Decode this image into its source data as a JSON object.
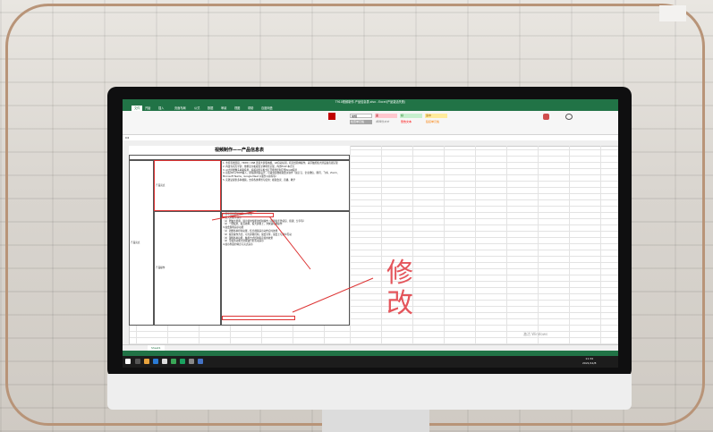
{
  "window": {
    "title": "T910视频制作-产品信息表.xlsx - Excel(产品激活失败)"
  },
  "tabs": [
    "文件",
    "开始",
    "插入",
    "页面布局",
    "公式",
    "数据",
    "审阅",
    "视图",
    "帮助",
    "百度网盘"
  ],
  "ribbon": {
    "styles": [
      "常规",
      "差",
      "好",
      "适中",
      "检查单元格",
      "解释性文本",
      "警告文本",
      "链接单元格"
    ],
    "accent": "#217346"
  },
  "formula_bar": {
    "name_box": "C4"
  },
  "sheet": {
    "title": "视频制作——产品信息表",
    "category": "产品亮点",
    "rows": [
      {
        "label": "产品亮点",
        "text": "1. 支持有线连接，HDMI / USB 连接大屏投电视，AP自动识别，机顶式简体操作，来带触控板大屏设备直观呈现\n2. 内置有机光学屏，便携显示和视觉立体场景呈现，内含ECW 本光灯\n3. AI大屏摄像头两路投屏，超超双屏平板式打开场景控制引擎AI/AR投屏\n4. 搭配AR与HDMI输入，即插即用装设计，可兼容多数视频会议软件（如钉钉、企业微信、腾讯、飞书、Zoom、Microsoft Teams、Google Meet 以服务以前等等）\n5. 实践证提供多种视频，支持各类场景与使用：视频会议、直播、教学"
      },
      {
        "label": "产品操作",
        "text": "1.简单连接即可识别HDMI线\n2.投大屏操作演示\n（1）轻触大屏幕，展示使用性能的控制操作（屏幕和手势感应、授课、分享等）\n（2）一键投屏，提高效率，投大屏幕上，并快速切换操作\n3.展会现场演示功能\n（1）调整各种控制功能，结合视频演示动作实时效果\n（2）投影操作方式，可大屏幕控制，展会宣传，展会上与观众互动\n（3）现场各种功能，触屏方式控制提高使用效果\n（4）带着新功能大屏幕进行的互动演示\n4.展示界面的特点与亮点演示"
      }
    ],
    "tab_name": "Sheet1"
  },
  "annotation": {
    "label": "修改",
    "color": "#e4555b"
  },
  "watermark": "激活 Windows",
  "taskbar": {
    "time": "11:34",
    "date": "2021/12/8"
  }
}
